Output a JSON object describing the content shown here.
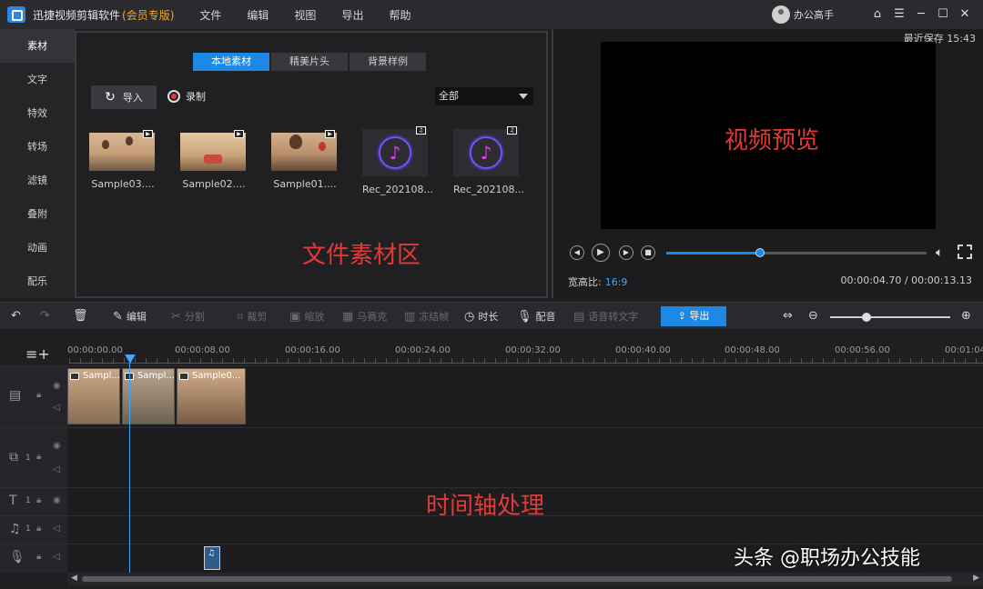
{
  "titlebar": {
    "app_name": "迅捷视频剪辑软件",
    "edition": "(会员专版)",
    "menu": [
      "文件",
      "编辑",
      "视图",
      "导出",
      "帮助"
    ],
    "user_name": "办公高手",
    "window_buttons": [
      "⌂",
      "☰",
      "─",
      "☐",
      "✕"
    ]
  },
  "leftnav": {
    "items": [
      "素材",
      "文字",
      "特效",
      "转场",
      "滤镜",
      "叠附",
      "动画",
      "配乐"
    ],
    "active": "素材"
  },
  "media": {
    "tabs": [
      "本地素材",
      "精美片头",
      "背景样例"
    ],
    "active_tab": "本地素材",
    "import_label": "导入",
    "record_label": "录制",
    "filter_value": "全部",
    "items": [
      {
        "label": "Sample03....",
        "kind": "video"
      },
      {
        "label": "Sample02....",
        "kind": "video"
      },
      {
        "label": "Sample01....",
        "kind": "video"
      },
      {
        "label": "Rec_202108...",
        "kind": "audio"
      },
      {
        "label": "Rec_202108...",
        "kind": "audio"
      }
    ],
    "area_label": "文件素材区"
  },
  "preview": {
    "last_save": "最近保存 15:43",
    "screen_label": "视频预览",
    "progress": 0.36,
    "ratio_label": "宽高比:",
    "ratio_value": "16:9",
    "timecode": "00:00:04.70 / 00:00:13.13"
  },
  "toolbar": {
    "edit": "编辑",
    "split": "分割",
    "crop": "裁剪",
    "zoom": "缩放",
    "mosaic": "马赛克",
    "freeze": "冻结帧",
    "duration": "时长",
    "dub": "配音",
    "speech_to_text": "语音转文字",
    "export": "导出",
    "zoom_level": 0.3
  },
  "timeline": {
    "ticks": [
      "00:00:00.00",
      "00:00:08.00",
      "00:00:16.00",
      "00:00:24.00",
      "00:00:32.00",
      "00:00:40.00",
      "00:00:48.00",
      "00:00:56.00",
      "00:01:04"
    ],
    "clips": [
      "Sampl...",
      "Sampl...",
      "Sample0..."
    ],
    "track_number": "1",
    "area_label": "时间轴处理"
  },
  "watermark": "头条 @职场办公技能",
  "colors": {
    "accent": "#1e88e5",
    "annotation": "#e53935",
    "edition": "#f5a623"
  }
}
